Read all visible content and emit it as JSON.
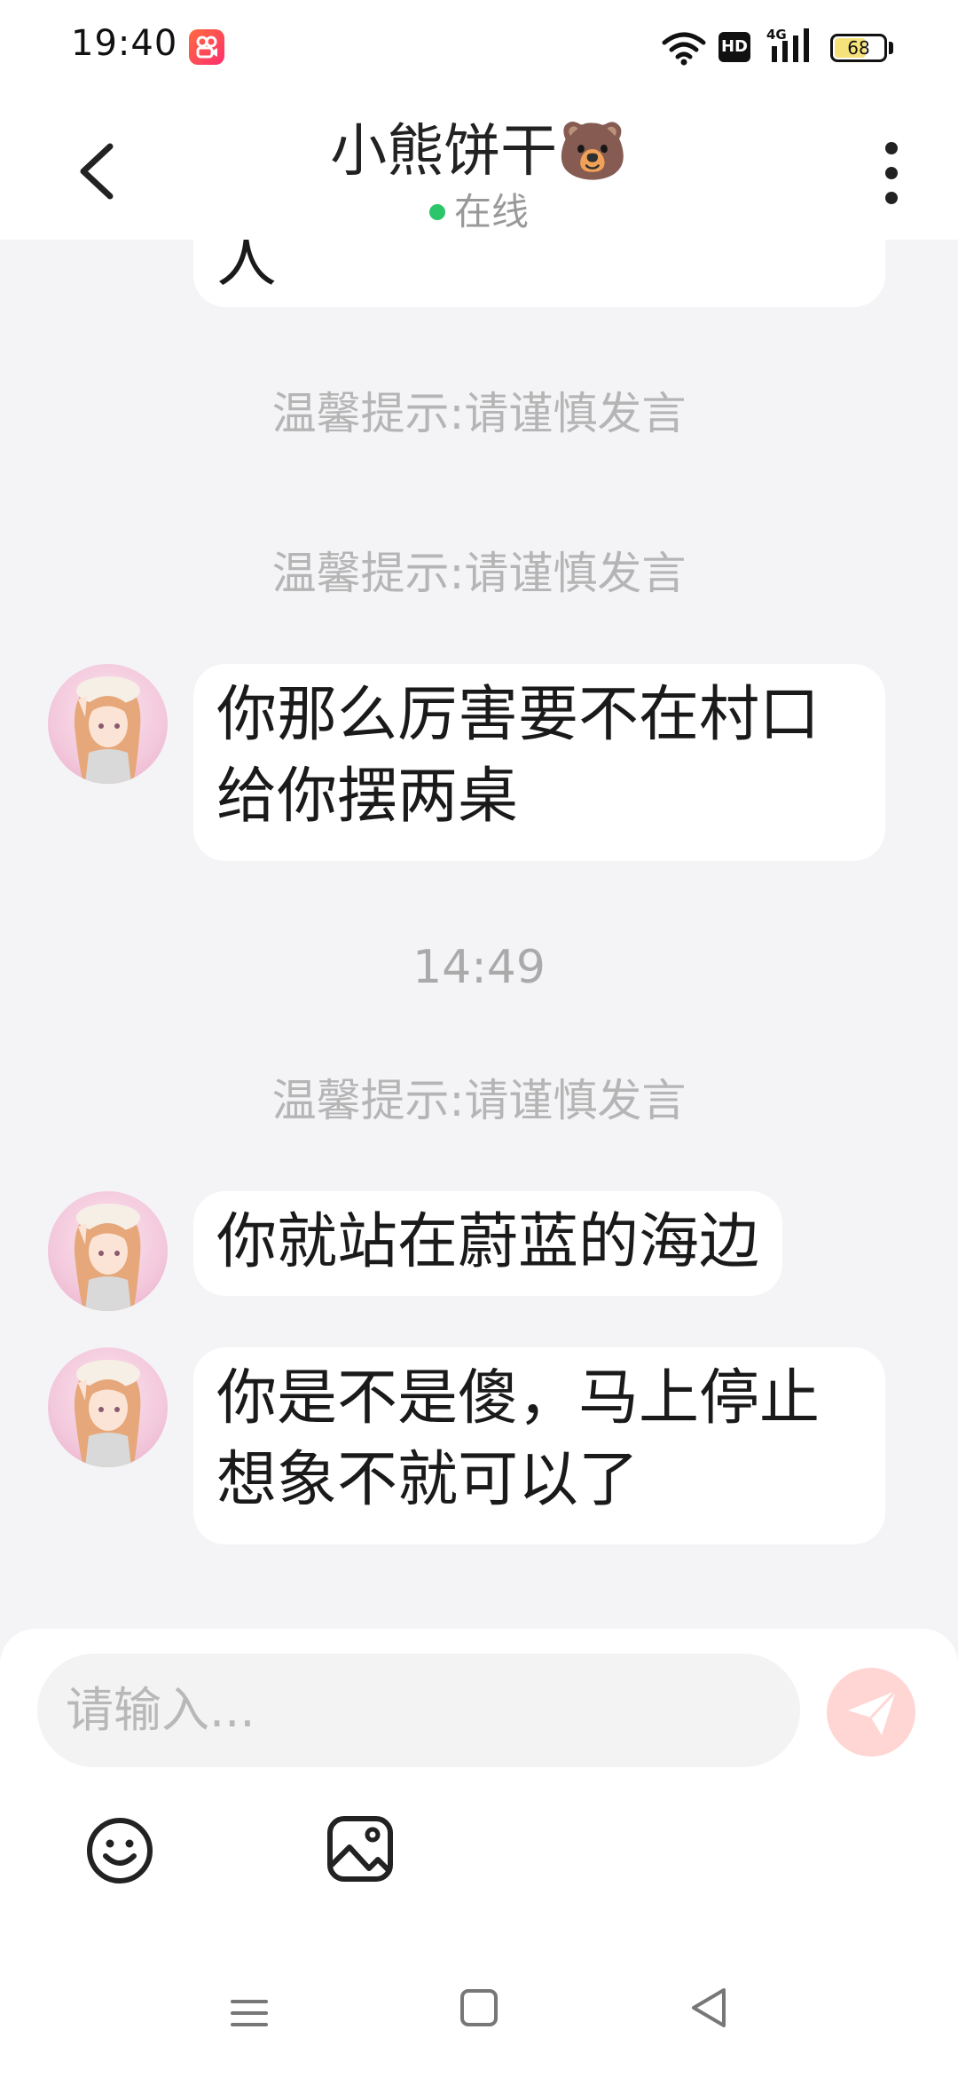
{
  "status_bar": {
    "time": "19:40",
    "app_icon": "video-app-icon",
    "network_badge": "HD",
    "signal_label": "4G",
    "battery_level": 68
  },
  "header": {
    "title": "小熊饼干🐻",
    "status": "在线",
    "status_color": "#2bc66a"
  },
  "messages": [
    {
      "type": "received",
      "text": "人"
    },
    {
      "type": "notice",
      "text": "温馨提示:请谨慎发言"
    },
    {
      "type": "notice",
      "text": "温馨提示:请谨慎发言"
    },
    {
      "type": "received",
      "text": "你那么厉害要不在村口给你摆两桌"
    },
    {
      "type": "time",
      "text": "14:49"
    },
    {
      "type": "notice",
      "text": "温馨提示:请谨慎发言"
    },
    {
      "type": "received",
      "text": "你就站在蔚蓝的海边"
    },
    {
      "type": "received",
      "text": "你是不是傻，马上停止想象不就可以了"
    }
  ],
  "composer": {
    "placeholder": "请输入...",
    "send_icon": "paper-plane-icon",
    "send_color": "#ffd6d3",
    "emoji_icon": "smiley-icon",
    "image_icon": "image-icon"
  },
  "nav": {
    "menu_icon": "menu-icon",
    "home_icon": "home-square-icon",
    "back_icon": "back-triangle-icon"
  }
}
